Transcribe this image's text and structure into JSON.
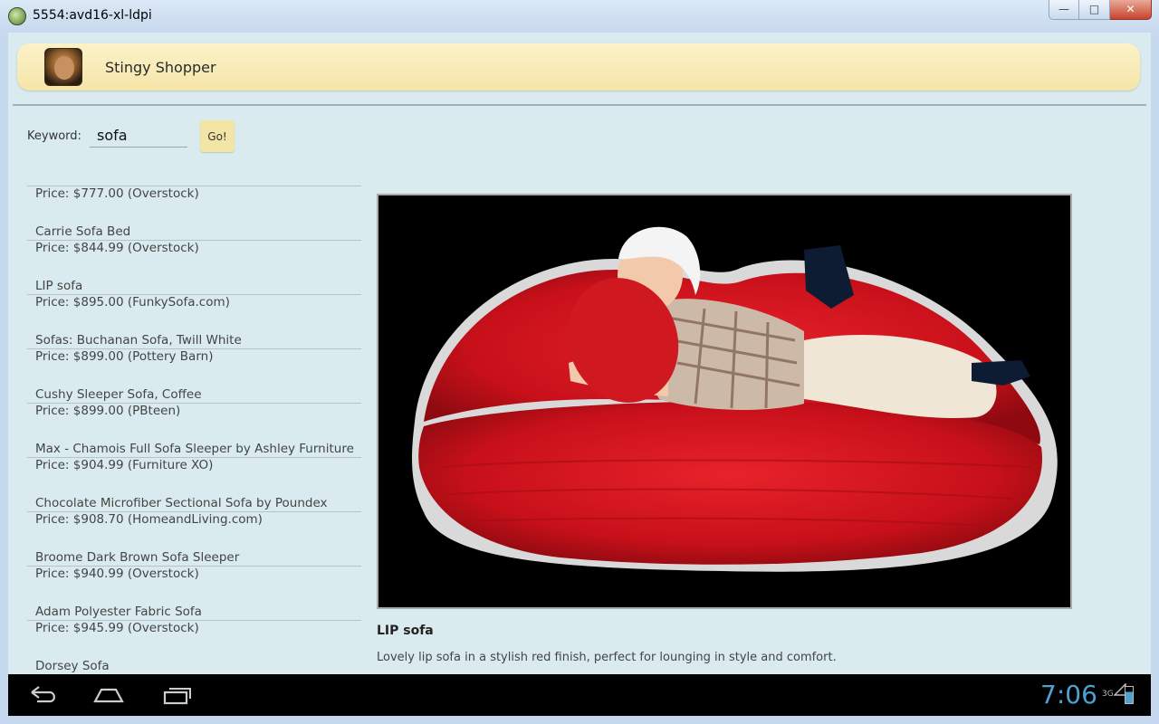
{
  "window": {
    "title": "5554:avd16-xl-ldpi",
    "controls": [
      "minimize",
      "maximize",
      "close"
    ]
  },
  "actionbar": {
    "app_name": "Stingy Shopper"
  },
  "search": {
    "label": "Keyword:",
    "value": "sofa",
    "button": "Go!"
  },
  "results": [
    {
      "name": "",
      "price": "Price: $777.00 (Overstock)"
    },
    {
      "name": "Carrie Sofa Bed",
      "price": "Price: $844.99 (Overstock)"
    },
    {
      "name": "LIP sofa",
      "price": "Price: $895.00 (FunkySofa.com)"
    },
    {
      "name": "Sofas: Buchanan Sofa, Twill White",
      "price": "Price: $899.00 (Pottery Barn)"
    },
    {
      "name": "Cushy Sleeper Sofa, Coffee",
      "price": "Price: $899.00 (PBteen)"
    },
    {
      "name": "Max - Chamois Full Sofa Sleeper by Ashley Furniture",
      "price": "Price: $904.99 (Furniture XO)"
    },
    {
      "name": "Chocolate Microfiber Sectional Sofa by Poundex",
      "price": "Price: $908.70 (HomeandLiving.com)"
    },
    {
      "name": "Broome Dark Brown Sofa Sleeper",
      "price": "Price: $940.99 (Overstock)"
    },
    {
      "name": "Adam Polyester Fabric Sofa",
      "price": "Price: $945.99 (Overstock)"
    },
    {
      "name": "Dorsey Sofa",
      "price": ""
    }
  ],
  "detail": {
    "title": "LIP sofa",
    "description": "Lovely lip sofa in a stylish red finish, perfect for lounging in style and comfort."
  },
  "statusbar": {
    "time": "7:06",
    "network": "3G"
  },
  "colors": {
    "actionbar": "#f6e8ad",
    "background": "#d9ebee",
    "clock": "#4ea1d3",
    "sofa": "#c8101a"
  }
}
